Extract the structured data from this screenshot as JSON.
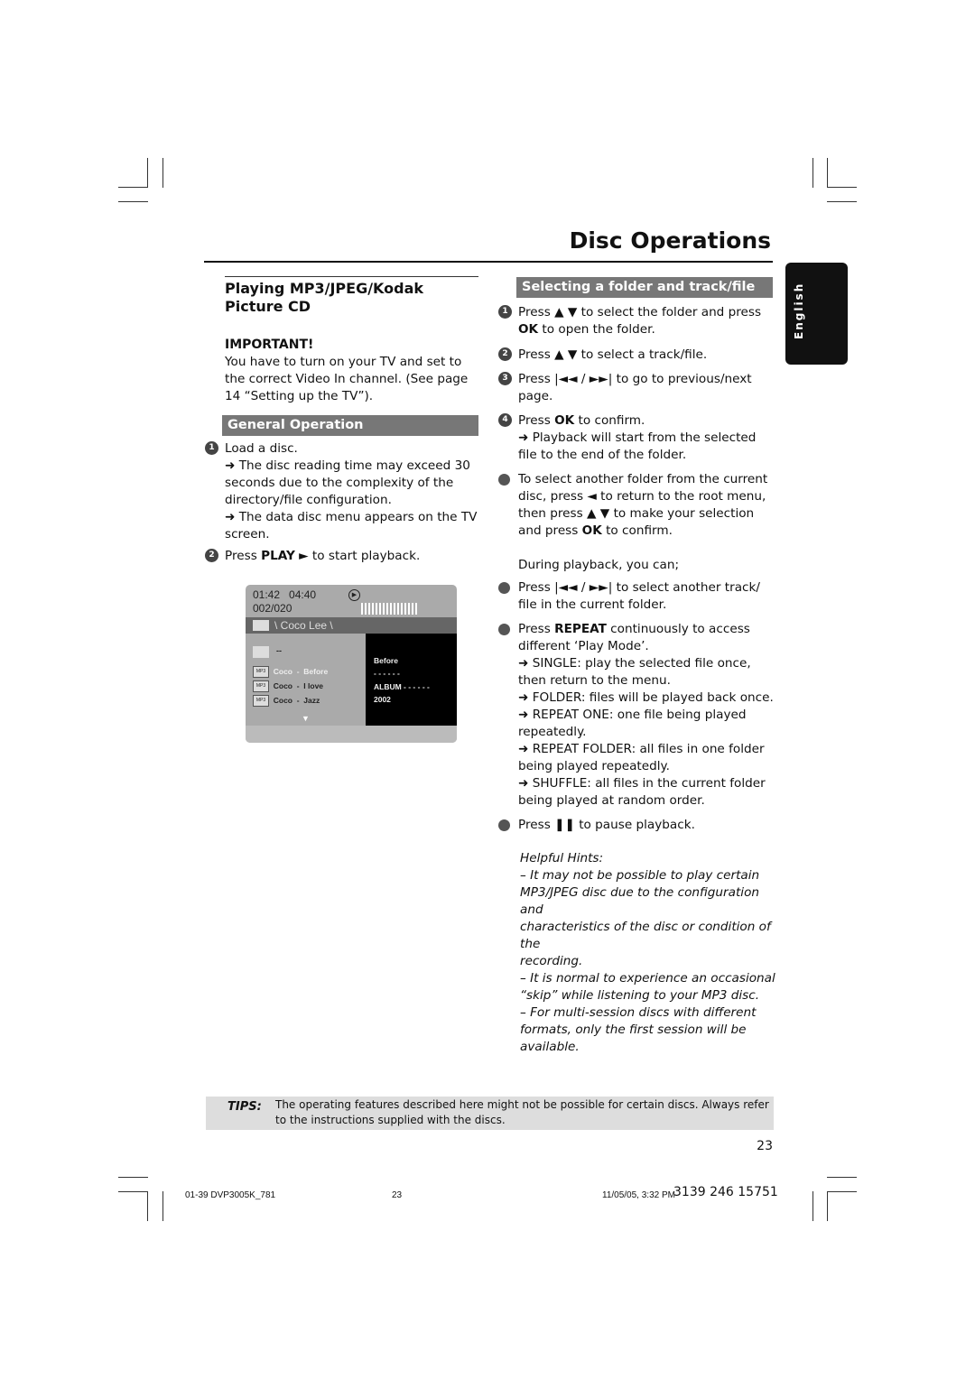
{
  "header": {
    "title": "Disc Operations",
    "side_tab": "English"
  },
  "left": {
    "section_title": "Playing MP3/JPEG/Kodak Picture CD",
    "important_label": "IMPORTANT!",
    "important_text": [
      "You have to turn on your TV and set to",
      "the correct Video In channel.  (See page",
      "14 “Setting up the TV”)."
    ],
    "band": "General Operation",
    "step1": {
      "num": "1",
      "line1": "Load a disc.",
      "arrow1": [
        "➜ The disc reading time may exceed 30",
        "seconds due to the complexity of the",
        "directory/file configuration."
      ],
      "arrow2": [
        "➜ The data disc menu appears on the TV",
        "screen."
      ]
    },
    "step2": {
      "num": "2",
      "pre": "Press ",
      "bold": "PLAY",
      "post": " ► to start playback."
    }
  },
  "screen": {
    "elapsed": "01:42",
    "total": "04:40",
    "track": "002/020",
    "folder": "\\ Coco Lee \\",
    "parent": "--",
    "files": [
      {
        "icon": "MP3",
        "artist": "Coco",
        "sep": "-",
        "title": "Before"
      },
      {
        "icon": "MP3",
        "artist": "Coco",
        "sep": "-",
        "title": "I love"
      },
      {
        "icon": "MP3",
        "artist": "Coco",
        "sep": "-",
        "title": "Jazz"
      }
    ],
    "info": [
      "Before",
      "- - - - - -",
      "ALBUM - - - - - -",
      "2002"
    ]
  },
  "right": {
    "band": "Selecting a folder and track/file",
    "s1": {
      "num": "1",
      "a": "Press ▲ ▼ to select the folder and press",
      "b": "OK",
      "c": " to open the folder."
    },
    "s2": {
      "num": "2",
      "a": "Press ▲ ▼ to select a track/file."
    },
    "s3": {
      "num": "3",
      "a": "Press |◄◄ / ►►|  to go to previous/next",
      "b": "page."
    },
    "s4": {
      "num": "4",
      "a": "Press ",
      "b": "OK",
      "c": " to confirm.",
      "arrow": [
        "➜ Playback will start from the selected",
        "file to the end of the folder."
      ]
    },
    "b1": {
      "lines": [
        "To select another folder from the current",
        "disc, press ◄ to return to the root menu,",
        "then press ▲ ▼ to make your selection"
      ],
      "a": "and press ",
      "b": "OK",
      "c": " to confirm."
    },
    "during": "During playback, you can;",
    "b2": [
      "Press |◄◄ / ►►| to select another track/",
      "file in the current folder."
    ],
    "b3": {
      "a": "Press ",
      "b": "REPEAT",
      "c": " continuously to access",
      "lines": [
        "different ‘Play Mode’.",
        "➜ SINGLE: play the selected file once,",
        "then return to the menu.",
        "➜ FOLDER: files will be played back once.",
        "➜ REPEAT ONE: one file being played",
        "repeatedly.",
        "➜ REPEAT FOLDER: all files in one folder",
        "being played repeatedly.",
        "➜ SHUFFLE: all files in the current folder",
        "being played at random order."
      ]
    },
    "b4": "Press ❚❚ to pause playback.",
    "hints_title": "Helpful Hints:",
    "hints": [
      "–    It may not be possible to play certain",
      "MP3/JPEG disc due to the configuration and",
      "characteristics of the disc or condition of the",
      "recording.",
      "–    It is normal to experience an occasional",
      "“skip” while listening to your MP3 disc.",
      "–    For multi-session discs with different",
      "formats, only the first session will be available."
    ]
  },
  "tips": {
    "label": "TIPS:",
    "lines": [
      "The operating features described here might not be possible for certain discs.  Always refer",
      "to the instructions supplied with the discs."
    ]
  },
  "page_number": "23",
  "footer": {
    "file": "01-39 DVP3005K_781",
    "page": "23",
    "date": "11/05/05, 3:32 PM",
    "code": "3139 246 15751"
  }
}
